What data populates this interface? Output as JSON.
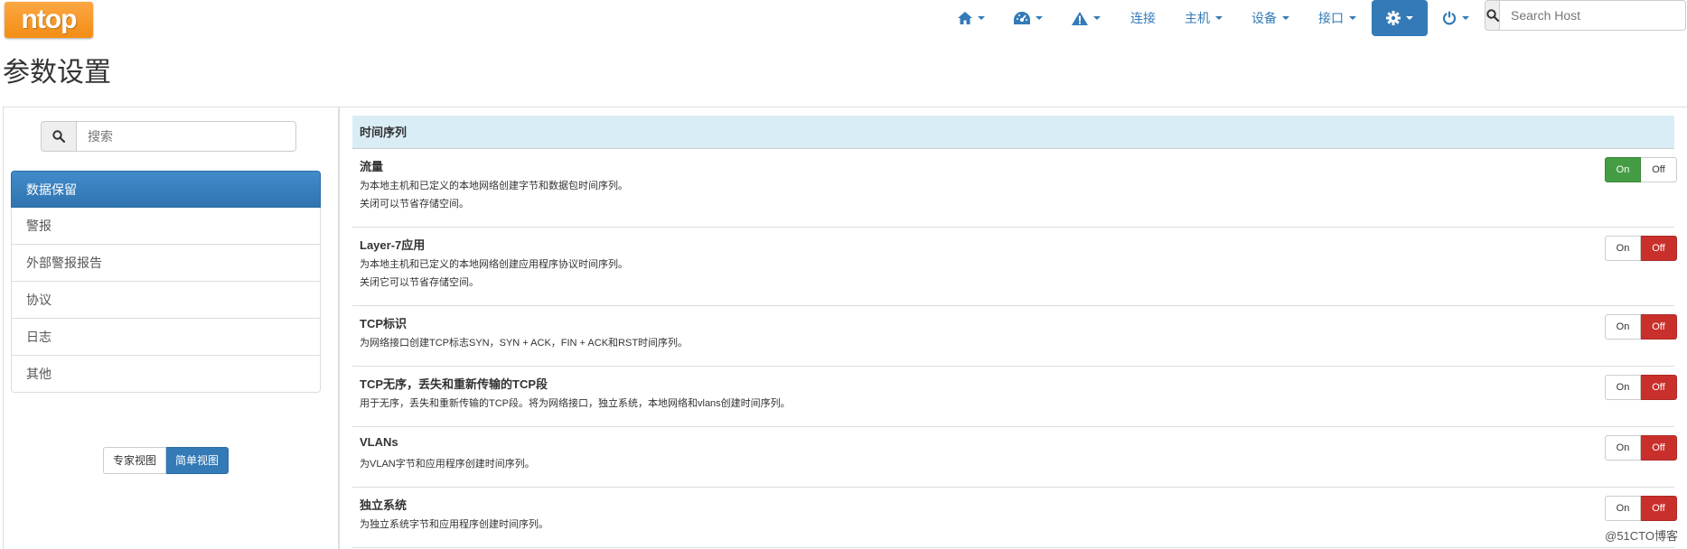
{
  "app": {
    "logo_text": "ntop"
  },
  "nav": {
    "items": [
      {
        "icon": "home-icon",
        "label": "",
        "caret": true
      },
      {
        "icon": "dashboard-icon",
        "label": "",
        "caret": true
      },
      {
        "icon": "alert-icon",
        "label": "",
        "caret": true
      },
      {
        "icon": "",
        "label": "连接",
        "caret": false
      },
      {
        "icon": "",
        "label": "主机",
        "caret": true
      },
      {
        "icon": "",
        "label": "设备",
        "caret": true
      },
      {
        "icon": "",
        "label": "接口",
        "caret": true
      },
      {
        "icon": "gear-icon",
        "label": "",
        "caret": true,
        "active": true
      },
      {
        "icon": "power-icon",
        "label": "",
        "caret": true
      }
    ],
    "search_placeholder": "Search Host"
  },
  "page": {
    "title": "参数设置"
  },
  "sidebar": {
    "search_placeholder": "搜索",
    "items": [
      {
        "label": "数据保留",
        "active": true
      },
      {
        "label": "警报",
        "active": false
      },
      {
        "label": "外部警报报告",
        "active": false
      },
      {
        "label": "协议",
        "active": false
      },
      {
        "label": "日志",
        "active": false
      },
      {
        "label": "其他",
        "active": false
      }
    ],
    "view_buttons": [
      {
        "label": "专家视图",
        "active": false
      },
      {
        "label": "简单视图",
        "active": true
      }
    ]
  },
  "content": {
    "section_title": "时间序列",
    "on_label": "On",
    "off_label": "Off",
    "prefs": [
      {
        "title": "流量",
        "desc": [
          "为本地主机和已定义的本地网络创建字节和数据包时间序列。",
          "关闭可以节省存储空间。"
        ],
        "state": "on"
      },
      {
        "title": "Layer-7应用",
        "desc": [
          "为本地主机和已定义的本地网络创建应用程序协议时间序列。",
          "关闭它可以节省存储空间。"
        ],
        "state": "off"
      },
      {
        "title": "TCP标识",
        "desc": [
          "为网络接口创建TCP标志SYN，SYN + ACK，FIN + ACK和RST时间序列。"
        ],
        "state": "off"
      },
      {
        "title": "TCP无序，丢失和重新传输的TCP段",
        "desc": [
          "用于无序，丢失和重新传输的TCP段。将为网络接口，独立系统，本地网络和vlans创建时间序列。"
        ],
        "state": "off"
      },
      {
        "title": "VLANs",
        "desc": [
          "为VLAN字节和应用程序创建时间序列。"
        ],
        "state": "off"
      },
      {
        "title": "独立系统",
        "desc": [
          "为独立系统字节和应用程序创建时间序列。"
        ],
        "state": "off"
      }
    ]
  },
  "watermark": "@51CTO博客",
  "colors": {
    "brand_orange": "#f38d14",
    "primary": "#337ab7",
    "on_green": "#449d44",
    "off_red": "#c9302c",
    "section_bg": "#d9edf7"
  }
}
